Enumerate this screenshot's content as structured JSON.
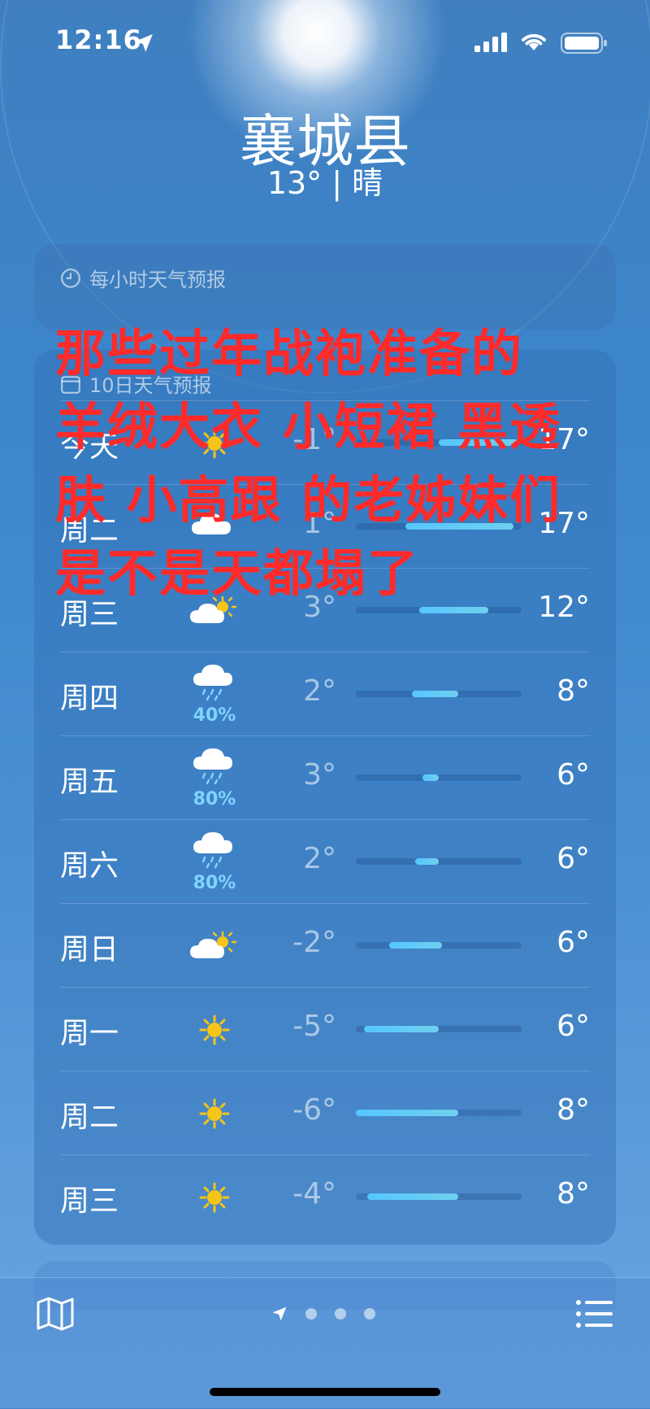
{
  "status": {
    "time": "12:16"
  },
  "header": {
    "city": "襄城县",
    "condition": "13°  |  晴"
  },
  "hourly": {
    "title": "每小时天气预报"
  },
  "daily": {
    "title": "10日天气预报",
    "rows": [
      {
        "day": "今天",
        "icon": "sun-icon",
        "precip": "",
        "low": "-1°",
        "high": "17°",
        "range": [
          0.5,
          0.98
        ]
      },
      {
        "day": "周二",
        "icon": "cloud-icon",
        "precip": "",
        "low": "1°",
        "high": "17°",
        "range": [
          0.3,
          0.95
        ]
      },
      {
        "day": "周三",
        "icon": "partly-sunny-icon",
        "precip": "",
        "low": "3°",
        "high": "12°",
        "range": [
          0.38,
          0.8
        ]
      },
      {
        "day": "周四",
        "icon": "rain-icon",
        "precip": "40%",
        "low": "2°",
        "high": "8°",
        "range": [
          0.34,
          0.62
        ]
      },
      {
        "day": "周五",
        "icon": "rain-icon",
        "precip": "80%",
        "low": "3°",
        "high": "6°",
        "range": [
          0.4,
          0.5
        ]
      },
      {
        "day": "周六",
        "icon": "rain-icon",
        "precip": "80%",
        "low": "2°",
        "high": "6°",
        "range": [
          0.36,
          0.5
        ]
      },
      {
        "day": "周日",
        "icon": "partly-sunny-icon",
        "precip": "",
        "low": "-2°",
        "high": "6°",
        "range": [
          0.2,
          0.52
        ]
      },
      {
        "day": "周一",
        "icon": "sun-icon",
        "precip": "",
        "low": "-5°",
        "high": "6°",
        "range": [
          0.05,
          0.5
        ]
      },
      {
        "day": "周二",
        "icon": "sun-icon",
        "precip": "",
        "low": "-6°",
        "high": "8°",
        "range": [
          0.0,
          0.62
        ]
      },
      {
        "day": "周三",
        "icon": "sun-icon",
        "precip": "",
        "low": "-4°",
        "high": "8°",
        "range": [
          0.07,
          0.62
        ]
      }
    ]
  },
  "overlay_text": [
    "那些过年战袍准备的",
    "羊绒大衣 小短裙 黑透",
    "肤 小高跟 的老姊妹们",
    "是不是天都塌了"
  ],
  "colors": {
    "overlay": "#ff2a2a",
    "precip": "#7fd3ff",
    "bar": "#55c6ff",
    "sun": "#f5c518"
  }
}
